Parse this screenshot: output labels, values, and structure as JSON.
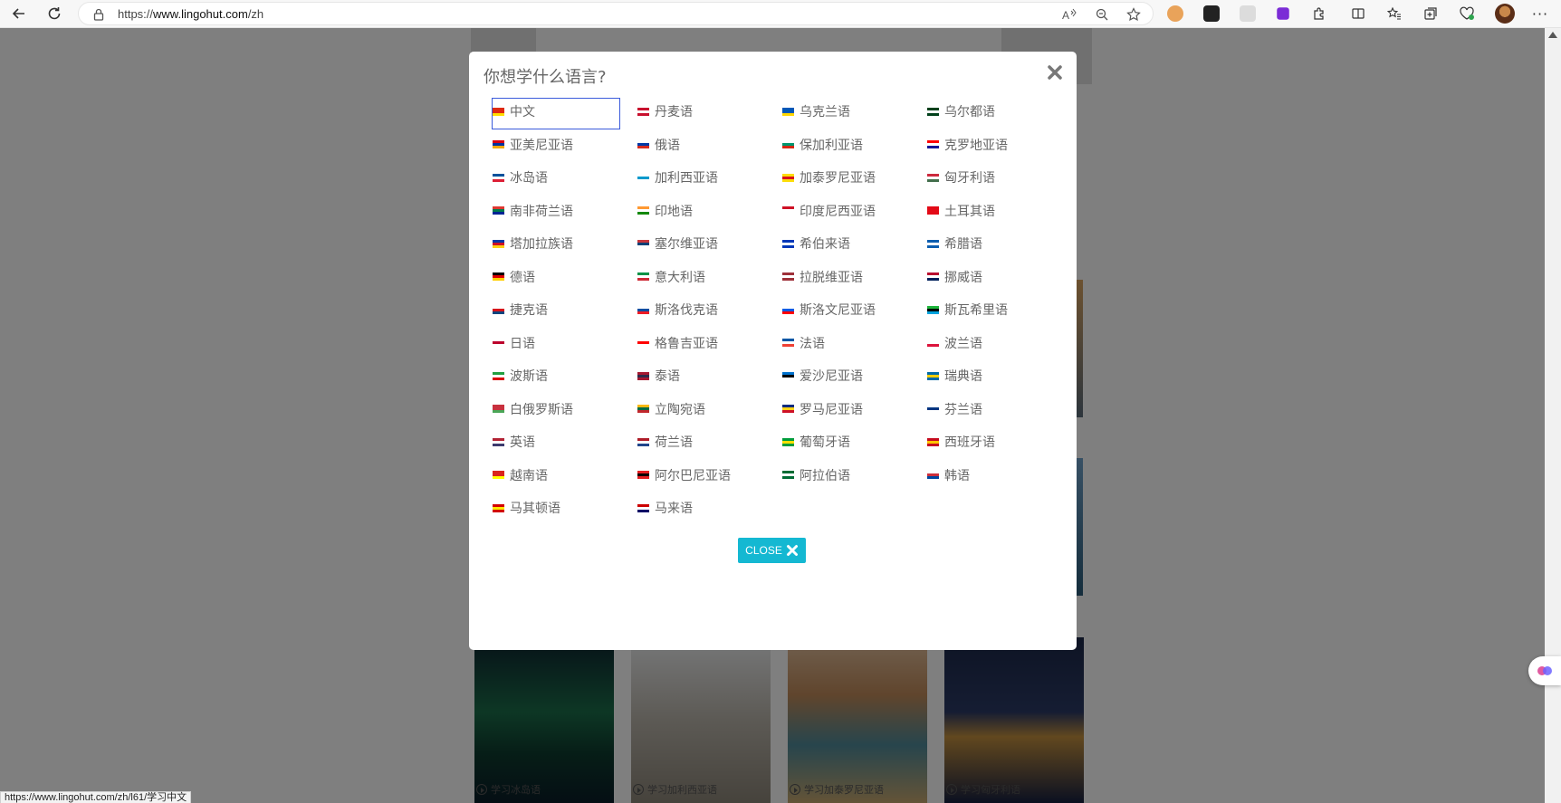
{
  "browser": {
    "url_scheme": "https://",
    "url_host": "www.lingohut.com",
    "url_path": "/zh",
    "status_url": "https://www.lingohut.com/zh/l61/学习中文"
  },
  "page": {
    "cards": [
      {
        "caption": "学习冰岛语",
        "color": "#1b6e4a"
      },
      {
        "caption": "学习加利西亚语",
        "color": "#b9b4aa"
      },
      {
        "caption": "学习加泰罗尼亚语",
        "color": "#c08a5a"
      },
      {
        "caption": "学习匈牙利语",
        "color": "#1c2848"
      }
    ]
  },
  "modal": {
    "title": "你想学什么语言?",
    "close_label": "CLOSE",
    "languages": [
      {
        "name": "中文",
        "flag": [
          "#de2910",
          "#de2910",
          "#ffde00"
        ],
        "selected": true
      },
      {
        "name": "丹麦语",
        "flag": [
          "#c8102e",
          "#ffffff",
          "#c8102e"
        ]
      },
      {
        "name": "乌克兰语",
        "flag": [
          "#0057b7",
          "#0057b7",
          "#ffd700"
        ]
      },
      {
        "name": "乌尔都语",
        "flag": [
          "#01411c",
          "#ffffff",
          "#01411c"
        ]
      },
      {
        "name": "亚美尼亚语",
        "flag": [
          "#d90012",
          "#0033a0",
          "#f2a800"
        ]
      },
      {
        "name": "俄语",
        "flag": [
          "#ffffff",
          "#0039a6",
          "#d52b1e"
        ]
      },
      {
        "name": "保加利亚语",
        "flag": [
          "#ffffff",
          "#00966e",
          "#d62612"
        ]
      },
      {
        "name": "克罗地亚语",
        "flag": [
          "#ff0000",
          "#ffffff",
          "#171796"
        ]
      },
      {
        "name": "冰岛语",
        "flag": [
          "#02529c",
          "#ffffff",
          "#dc1e35"
        ]
      },
      {
        "name": "加利西亚语",
        "flag": [
          "#ffffff",
          "#0099cc",
          "#ffffff"
        ]
      },
      {
        "name": "加泰罗尼亚语",
        "flag": [
          "#fcdd09",
          "#da121a",
          "#fcdd09"
        ]
      },
      {
        "name": "匈牙利语",
        "flag": [
          "#cd2a3e",
          "#ffffff",
          "#436f4d"
        ]
      },
      {
        "name": "南非荷兰语",
        "flag": [
          "#de3831",
          "#007a4d",
          "#002395"
        ]
      },
      {
        "name": "印地语",
        "flag": [
          "#ff9933",
          "#ffffff",
          "#138808"
        ]
      },
      {
        "name": "印度尼西亚语",
        "flag": [
          "#ce1126",
          "#ffffff",
          "#ffffff"
        ]
      },
      {
        "name": "土耳其语",
        "flag": [
          "#e30a17",
          "#e30a17",
          "#e30a17"
        ]
      },
      {
        "name": "塔加拉族语",
        "flag": [
          "#0038a8",
          "#ce1126",
          "#fcd116"
        ]
      },
      {
        "name": "塞尔维亚语",
        "flag": [
          "#c6363c",
          "#0c4076",
          "#ffffff"
        ]
      },
      {
        "name": "希伯来语",
        "flag": [
          "#0038b8",
          "#ffffff",
          "#0038b8"
        ]
      },
      {
        "name": "希腊语",
        "flag": [
          "#0d5eaf",
          "#ffffff",
          "#0d5eaf"
        ]
      },
      {
        "name": "德语",
        "flag": [
          "#000000",
          "#dd0000",
          "#ffce00"
        ]
      },
      {
        "name": "意大利语",
        "flag": [
          "#009246",
          "#ffffff",
          "#ce2b37"
        ]
      },
      {
        "name": "拉脱维亚语",
        "flag": [
          "#9e3039",
          "#ffffff",
          "#9e3039"
        ]
      },
      {
        "name": "挪威语",
        "flag": [
          "#ba0c2f",
          "#ffffff",
          "#00205b"
        ]
      },
      {
        "name": "捷克语",
        "flag": [
          "#ffffff",
          "#d7141a",
          "#11457e"
        ]
      },
      {
        "name": "斯洛伐克语",
        "flag": [
          "#ffffff",
          "#0b4ea2",
          "#ee1c25"
        ]
      },
      {
        "name": "斯洛文尼亚语",
        "flag": [
          "#ffffff",
          "#005ce5",
          "#ff0000"
        ]
      },
      {
        "name": "斯瓦希里语",
        "flag": [
          "#1eb53a",
          "#000000",
          "#00a3dd"
        ]
      },
      {
        "name": "日语",
        "flag": [
          "#ffffff",
          "#bc002d",
          "#ffffff"
        ]
      },
      {
        "name": "格鲁吉亚语",
        "flag": [
          "#ffffff",
          "#ff0000",
          "#ffffff"
        ]
      },
      {
        "name": "法语",
        "flag": [
          "#0055a4",
          "#ffffff",
          "#ef4135"
        ]
      },
      {
        "name": "波兰语",
        "flag": [
          "#ffffff",
          "#ffffff",
          "#dc143c"
        ]
      },
      {
        "name": "波斯语",
        "flag": [
          "#239f40",
          "#ffffff",
          "#da0000"
        ]
      },
      {
        "name": "泰语",
        "flag": [
          "#a51931",
          "#2d2a4a",
          "#a51931"
        ]
      },
      {
        "name": "爱沙尼亚语",
        "flag": [
          "#0072ce",
          "#000000",
          "#ffffff"
        ]
      },
      {
        "name": "瑞典语",
        "flag": [
          "#006aa7",
          "#fecc00",
          "#006aa7"
        ]
      },
      {
        "name": "白俄罗斯语",
        "flag": [
          "#c8313e",
          "#c8313e",
          "#4aa657"
        ]
      },
      {
        "name": "立陶宛语",
        "flag": [
          "#fdb913",
          "#006a44",
          "#c1272d"
        ]
      },
      {
        "name": "罗马尼亚语",
        "flag": [
          "#002b7f",
          "#fcd116",
          "#ce1126"
        ]
      },
      {
        "name": "芬兰语",
        "flag": [
          "#ffffff",
          "#003580",
          "#ffffff"
        ]
      },
      {
        "name": "英语",
        "flag": [
          "#b22234",
          "#ffffff",
          "#3c3b6e"
        ]
      },
      {
        "name": "荷兰语",
        "flag": [
          "#ae1c28",
          "#ffffff",
          "#21468b"
        ]
      },
      {
        "name": "葡萄牙语",
        "flag": [
          "#009c3b",
          "#ffdf00",
          "#009c3b"
        ]
      },
      {
        "name": "西班牙语",
        "flag": [
          "#c60b1e",
          "#ffc400",
          "#c60b1e"
        ]
      },
      {
        "name": "越南语",
        "flag": [
          "#da251d",
          "#da251d",
          "#ffff00"
        ]
      },
      {
        "name": "阿尔巴尼亚语",
        "flag": [
          "#e41e20",
          "#000000",
          "#e41e20"
        ]
      },
      {
        "name": "阿拉伯语",
        "flag": [
          "#006c35",
          "#ffffff",
          "#006c35"
        ]
      },
      {
        "name": "韩语",
        "flag": [
          "#ffffff",
          "#cd2e3a",
          "#0047a0"
        ]
      },
      {
        "name": "马其顿语",
        "flag": [
          "#d20000",
          "#ffe600",
          "#d20000"
        ]
      },
      {
        "name": "马来语",
        "flag": [
          "#cc0001",
          "#ffffff",
          "#010066"
        ]
      }
    ]
  },
  "colors": {
    "accent": "#14b8d2",
    "selected_border": "#3b5bdb"
  }
}
